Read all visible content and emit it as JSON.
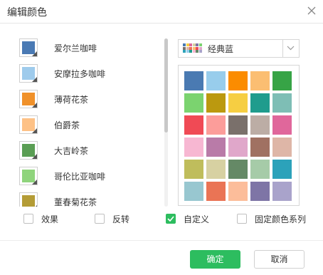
{
  "dialog": {
    "title": "编辑颜色"
  },
  "color_list": {
    "items": [
      {
        "label": "爱尔兰咖啡",
        "color": "#4a7ab4"
      },
      {
        "label": "安摩拉多咖啡",
        "color": "#9ecbec"
      },
      {
        "label": "薄荷花茶",
        "color": "#f0912a"
      },
      {
        "label": "伯爵茶",
        "color": "#fdc186"
      },
      {
        "label": "大吉岭茶",
        "color": "#5a9e54"
      },
      {
        "label": "哥伦比亚咖啡",
        "color": "#8fd47c"
      },
      {
        "label": "董春菊花茶",
        "color": "#b49c36"
      }
    ]
  },
  "scheme": {
    "label": "经典蓝",
    "dropdown_icon": "chevron-down-icon"
  },
  "palette": {
    "colors": [
      "#4a7ab2",
      "#98cdec",
      "#fb8c00",
      "#fbbe72",
      "#37a446",
      "#7bd36f",
      "#bb990f",
      "#f6ce42",
      "#1f9c8d",
      "#7ebeb5",
      "#f04a55",
      "#fc9d9a",
      "#7a706b",
      "#bcada5",
      "#e0679b",
      "#f7b7d2",
      "#b97ba8",
      "#e0a7ca",
      "#a07162",
      "#deb6a7",
      "#bfbd5c",
      "#d7d1a2",
      "#658966",
      "#a6cba8",
      "#2ca2ba",
      "#98c7d0",
      "#ea7455",
      "#fcbd9a",
      "#7e75a6",
      "#a9a3cb"
    ]
  },
  "options": [
    {
      "label": "效果",
      "checked": false
    },
    {
      "label": "反转",
      "checked": false
    },
    {
      "label": "自定义",
      "checked": true
    },
    {
      "label": "固定颜色系列",
      "checked": false
    }
  ],
  "buttons": {
    "ok": "确定",
    "cancel": "取消"
  },
  "accent_color": "#2dbd5f"
}
